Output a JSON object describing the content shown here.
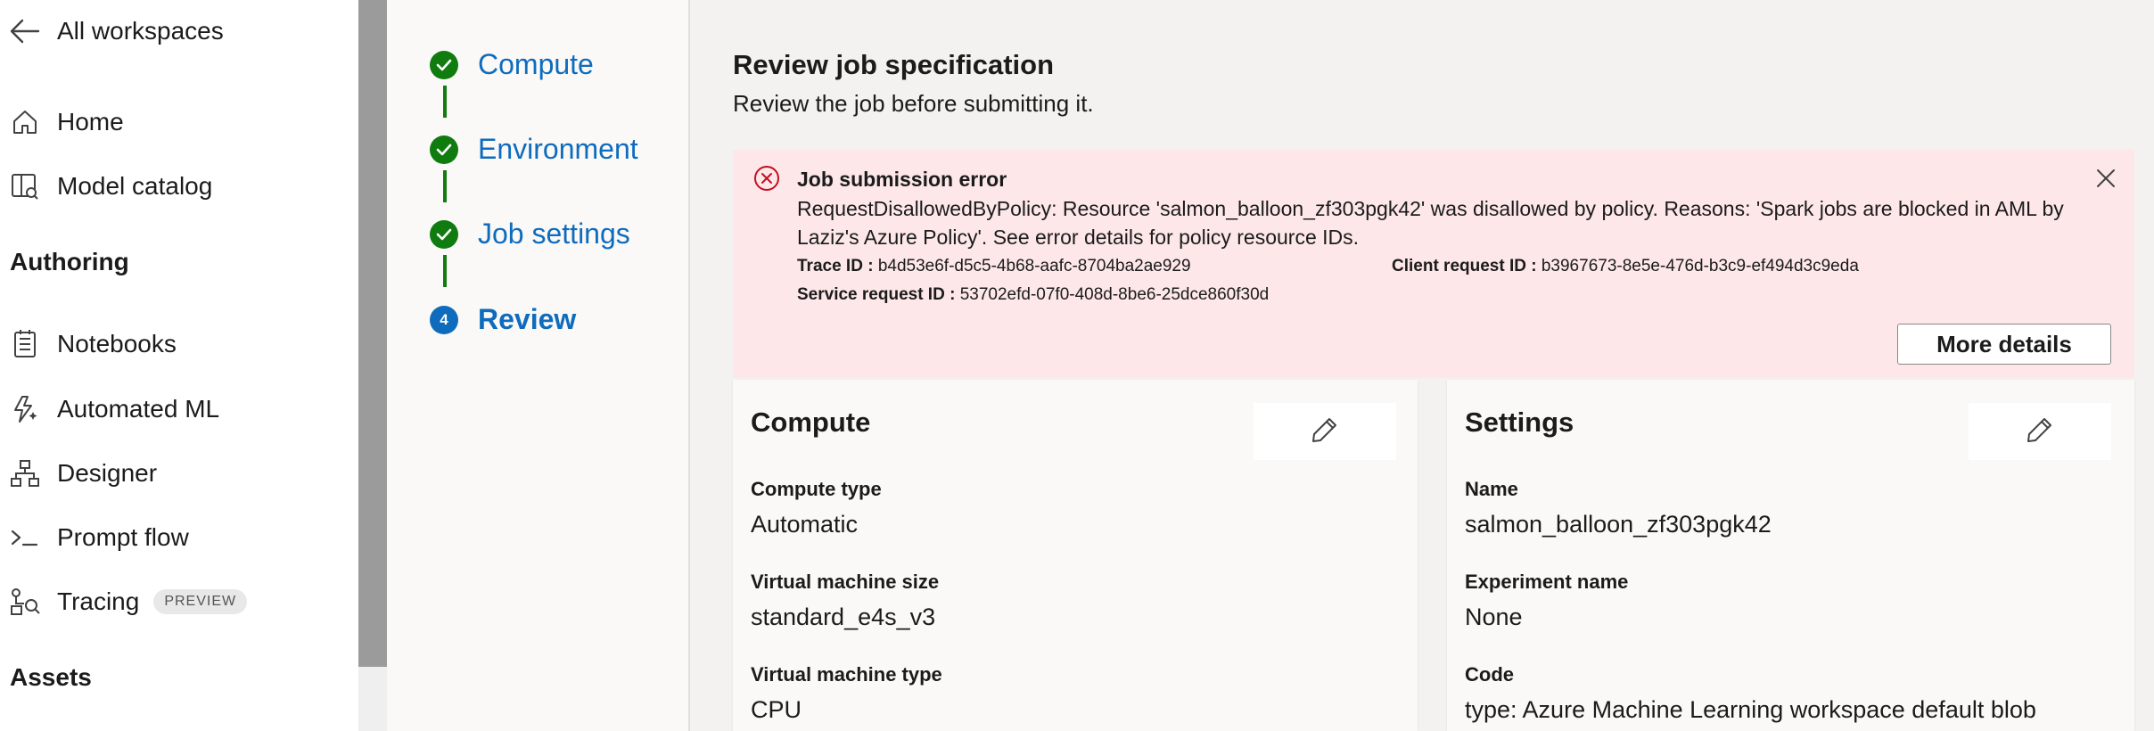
{
  "nav": {
    "back_label": "All workspaces",
    "items_top": [
      {
        "label": "Home",
        "icon": "home-icon"
      },
      {
        "label": "Model catalog",
        "icon": "model-catalog-icon"
      }
    ],
    "section_authoring": "Authoring",
    "items_authoring": [
      {
        "label": "Notebooks",
        "icon": "notebook-icon"
      },
      {
        "label": "Automated ML",
        "icon": "automated-ml-icon"
      },
      {
        "label": "Designer",
        "icon": "designer-icon"
      },
      {
        "label": "Prompt flow",
        "icon": "prompt-flow-icon"
      },
      {
        "label": "Tracing",
        "icon": "tracing-icon",
        "badge": "PREVIEW"
      }
    ],
    "section_assets": "Assets"
  },
  "steps": [
    {
      "label": "Compute",
      "state": "done"
    },
    {
      "label": "Environment",
      "state": "done"
    },
    {
      "label": "Job settings",
      "state": "done"
    },
    {
      "label": "Review",
      "state": "current",
      "number": "4"
    }
  ],
  "review": {
    "title": "Review job specification",
    "subtitle": "Review the job before submitting it."
  },
  "error": {
    "title": "Job submission error",
    "message": "RequestDisallowedByPolicy: Resource 'salmon_balloon_zf303pgk42' was disallowed by policy. Reasons: 'Spark jobs are blocked in AML by Laziz's Azure Policy'. See error details for policy resource IDs.",
    "trace_label": "Trace ID :",
    "trace_value": "b4d53e6f-d5c5-4b68-aafc-8704ba2ae929",
    "client_label": "Client request ID :",
    "client_value": "b3967673-8e5e-476d-b3c9-ef494d3c9eda",
    "service_label": "Service request ID :",
    "service_value": "53702efd-07f0-408d-8be6-25dce860f30d",
    "more_details_label": "More details"
  },
  "compute_card": {
    "title": "Compute",
    "fields": [
      {
        "label": "Compute type",
        "value": "Automatic"
      },
      {
        "label": "Virtual machine size",
        "value": "standard_e4s_v3"
      },
      {
        "label": "Virtual machine type",
        "value": "CPU"
      }
    ]
  },
  "settings_card": {
    "title": "Settings",
    "fields": [
      {
        "label": "Name",
        "value": "salmon_balloon_zf303pgk42"
      },
      {
        "label": "Experiment name",
        "value": "None"
      },
      {
        "label": "Code",
        "value": "type: Azure Machine Learning workspace default blob"
      }
    ]
  },
  "colors": {
    "accent": "#0f6cbd",
    "success": "#107c10",
    "error_bg": "#fde7e9",
    "error_icon": "#c50f1f"
  }
}
